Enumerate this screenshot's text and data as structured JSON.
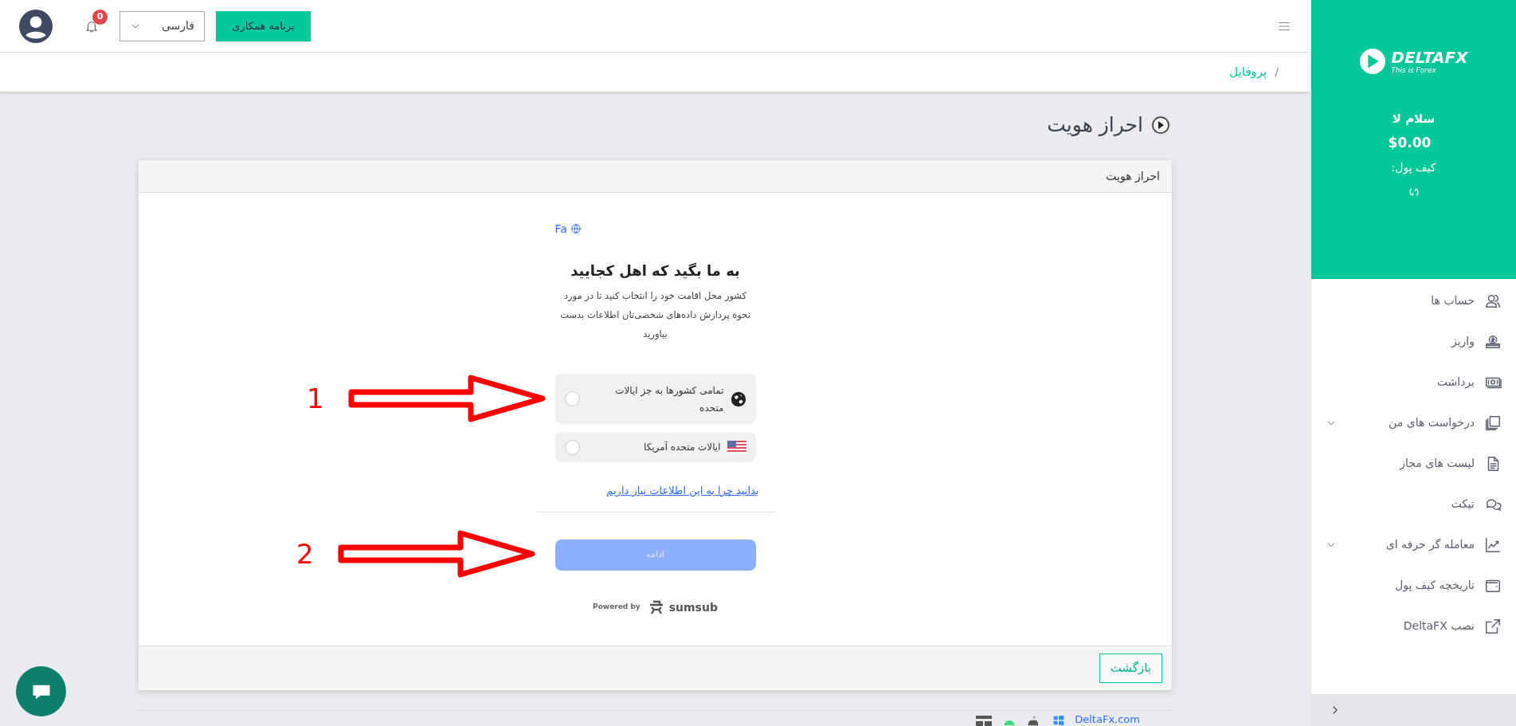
{
  "topbar": {
    "affiliate_button": "برنامه همکاری",
    "language_select": "فارسی",
    "notifications_badge": "0"
  },
  "breadcrumb": {
    "separator": "/",
    "item": "پروفایل"
  },
  "page_title": "احراز هویت",
  "card": {
    "header": "احراز هویت",
    "widget": {
      "language": "Fa",
      "heading": "به ما بگید که اهل کجایید",
      "description": "کشور محل اقامت خود را انتخاب کنید تا در مورد نحوه پردازش داده‌های شخصی‌تان اطلاعات بدست بیاورید",
      "options": [
        {
          "kind": "globe",
          "label": "تمامی کشورها به جز ایالات متحده",
          "selected": false
        },
        {
          "kind": "us-flag",
          "label": "ایالات متحده آمریکا",
          "selected": false
        }
      ],
      "link": "بدانید چرا به این اطلاعات نیاز داریم",
      "continue_button": {
        "label": "ادامه",
        "disabled": true
      },
      "powered_by": "Powered by",
      "brand": "sumsub"
    },
    "back_button": "بازگشت"
  },
  "annotations": [
    {
      "label": "1"
    },
    {
      "label": "2"
    }
  ],
  "footer": {
    "site": "DeltaFx.com"
  },
  "sidebar": {
    "logo": {
      "name": "DELTAFX",
      "tagline": "This is Forex"
    },
    "greeting": "سلام لا",
    "balance": "$0.00",
    "wallet_label": "کیف پول:",
    "menu": [
      {
        "label": "حساب ها",
        "expandable": false
      },
      {
        "label": "واریز",
        "expandable": false
      },
      {
        "label": "برداشت",
        "expandable": false
      },
      {
        "label": "درخواست های من",
        "expandable": true
      },
      {
        "label": "لیست های مجاز",
        "expandable": false
      },
      {
        "label": "تیکت",
        "expandable": false
      },
      {
        "label": "معامله گر حرفه ای",
        "expandable": true
      },
      {
        "label": "تاریخچه کیف پول",
        "expandable": false
      },
      {
        "label": "نصب DeltaFX",
        "expandable": false
      }
    ]
  }
}
